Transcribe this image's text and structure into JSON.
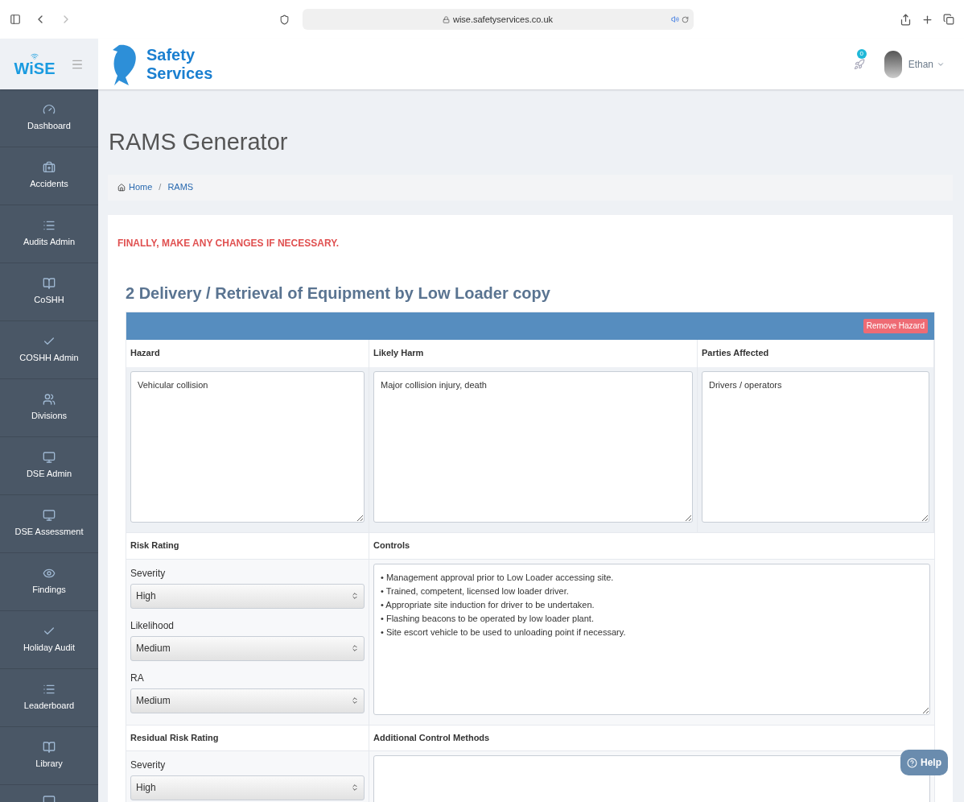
{
  "browser": {
    "url": "wise.safetyservices.co.uk"
  },
  "header": {
    "app_logo": "WiSE",
    "brand": [
      "Safety",
      "Services"
    ],
    "notification_count": "0",
    "user": "Ethan"
  },
  "sidebar": {
    "items": [
      {
        "label": "Dashboard"
      },
      {
        "label": "Accidents"
      },
      {
        "label": "Audits Admin"
      },
      {
        "label": "CoSHH"
      },
      {
        "label": "COSHH Admin"
      },
      {
        "label": "Divisions"
      },
      {
        "label": "DSE Admin"
      },
      {
        "label": "DSE Assessment"
      },
      {
        "label": "Findings"
      },
      {
        "label": "Holiday Audit"
      },
      {
        "label": "Leaderboard"
      },
      {
        "label": "Library"
      }
    ]
  },
  "page": {
    "title": "RAMS Generator",
    "breadcrumb": [
      "Home",
      "RAMS"
    ],
    "breadcrumb_separator": "/"
  },
  "notice": "FINALLY, MAKE ANY CHANGES IF NECESSARY.",
  "hazard_block": {
    "title": "2 Delivery / Retrieval of Equipment by Low Loader copy",
    "remove_button": "Remove Hazard",
    "columns": [
      "Hazard",
      "Likely Harm",
      "Parties Affected"
    ],
    "values": [
      "Vehicular collision",
      "Major collision injury, death",
      "Drivers / operators"
    ],
    "risk_rating": {
      "heading": "Risk Rating",
      "fields": [
        {
          "label": "Severity",
          "value": "High"
        },
        {
          "label": "Likelihood",
          "value": "Medium"
        },
        {
          "label": "RA",
          "value": "Medium"
        }
      ]
    },
    "controls": {
      "heading": "Controls",
      "lines": [
        "• Management approval prior to Low Loader accessing site.",
        "• Trained, competent, licensed low loader driver.",
        "• Appropriate site induction for driver to be undertaken.",
        "• Flashing beacons to be operated by low loader plant.",
        "• Site escort vehicle to be used to unloading point if necessary."
      ]
    },
    "residual_risk_rating": {
      "heading": "Residual Risk Rating",
      "fields": [
        {
          "label": "Severity",
          "value": "High"
        }
      ]
    },
    "additional_controls": {
      "heading": "Additional Control Methods"
    }
  },
  "help_button": "Help"
}
